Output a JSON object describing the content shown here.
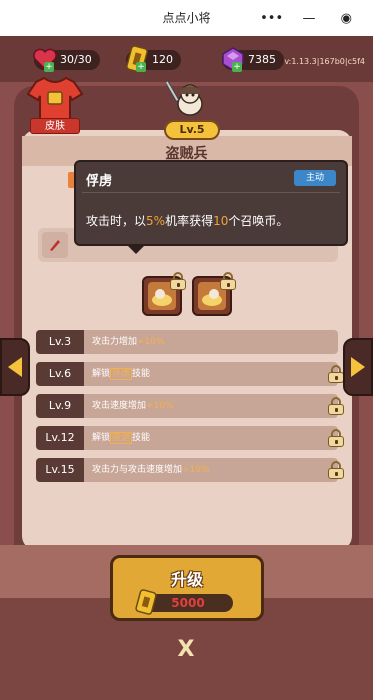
{
  "topbar": {
    "title": "点点小将",
    "menu_icon": "more-dots-icon",
    "minimize_icon": "minimize-icon",
    "close_icon": "target-close-icon",
    "more_glyph": "•••",
    "minimize_glyph": "—",
    "close_glyph": "◉"
  },
  "resources": {
    "hearts": "30/30",
    "tickets": "120",
    "gems": "7385"
  },
  "version": "v:1.13.3|167b0|c5f4",
  "skin_button": {
    "label": "皮肤"
  },
  "character": {
    "level": "Lv.5",
    "name": "盗贼兵"
  },
  "tooltip": {
    "title": "俘虏",
    "tag": "主动",
    "desc_pre": "攻击时，以",
    "desc_pct": "5%",
    "desc_mid": "机率获得",
    "desc_num": "10",
    "desc_post": "个召唤币。"
  },
  "upgrades": [
    {
      "level": "Lv.3",
      "pre": "攻击力增加",
      "pct": "+10%",
      "locked": false
    },
    {
      "level": "Lv.6",
      "pre": "解锁",
      "box": "俘虏",
      "post": "技能",
      "locked": true
    },
    {
      "level": "Lv.9",
      "pre": "攻击速度增加",
      "pct": "+10%",
      "locked": true
    },
    {
      "level": "Lv.12",
      "pre": "解锁",
      "box": "撤退",
      "post": "技能",
      "locked": true
    },
    {
      "level": "Lv.15",
      "pre": "攻击力与攻击速度增加",
      "pct": "+10%",
      "locked": true
    }
  ],
  "upgrade_button": {
    "label": "升级",
    "cost": "5000"
  },
  "close_glyph": "X",
  "colors": {
    "accent": "#f5c33b",
    "highlight": "#f0a33a",
    "cost": "#e04040",
    "tag": "#3b87c9"
  }
}
